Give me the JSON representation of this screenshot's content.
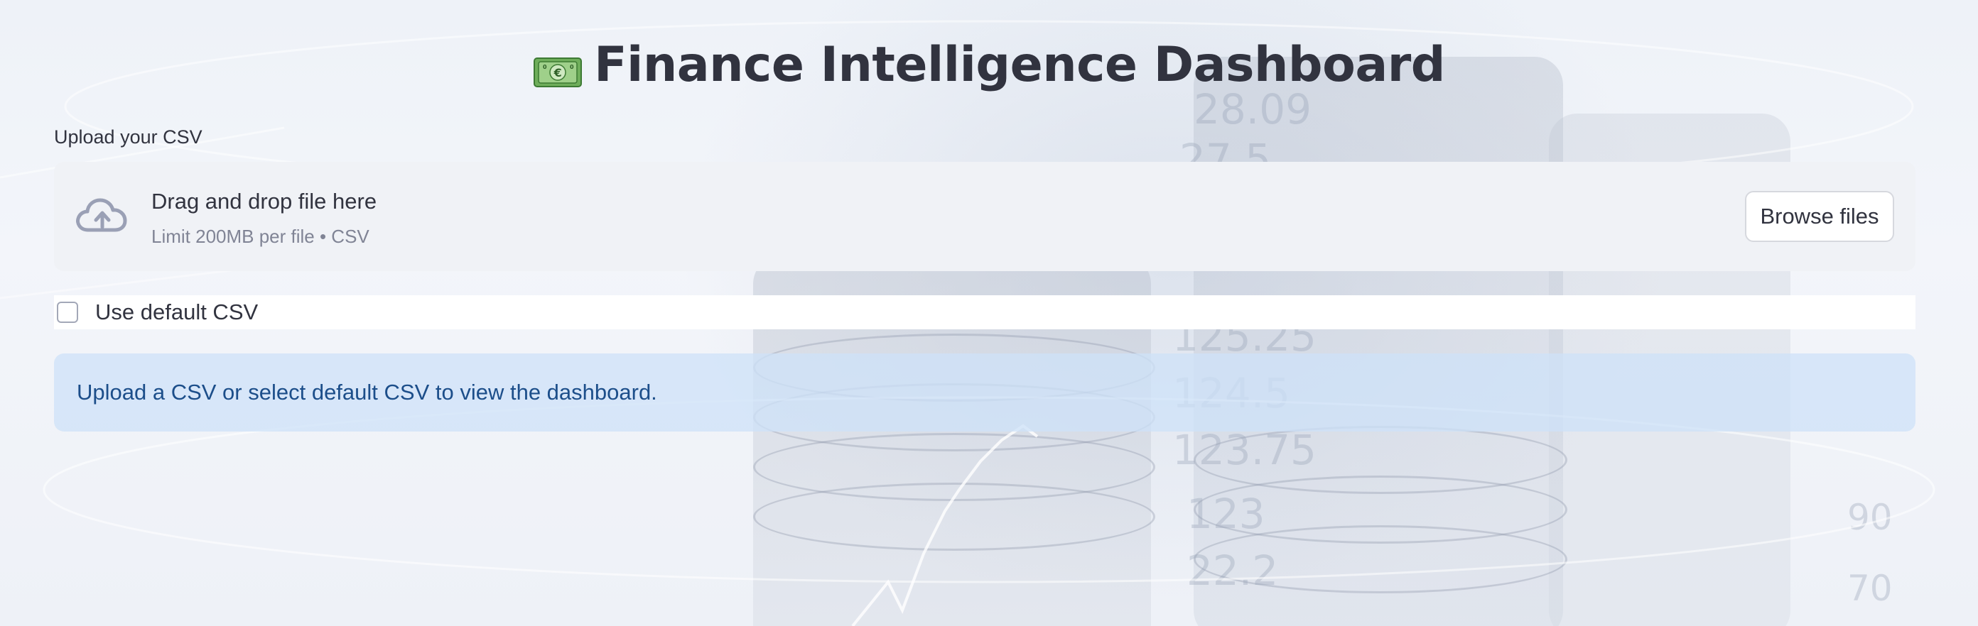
{
  "header": {
    "icon": "money-banknote-icon",
    "title": "Finance Intelligence Dashboard"
  },
  "uploader": {
    "label": "Upload your CSV",
    "dropzone_text": "Drag and drop file here",
    "limit_text": "Limit 200MB per file • CSV",
    "browse_label": "Browse files",
    "icon": "cloud-upload-icon"
  },
  "default_option": {
    "label": "Use default CSV",
    "checked": false
  },
  "notice": {
    "text": "Upload a CSV or select default CSV to view the dashboard."
  },
  "colors": {
    "text": "#31333f",
    "muted": "#808495",
    "dropzone_bg": "#f0f2f6",
    "info_bg": "#cee1f8",
    "info_text": "#1c4e8a"
  }
}
